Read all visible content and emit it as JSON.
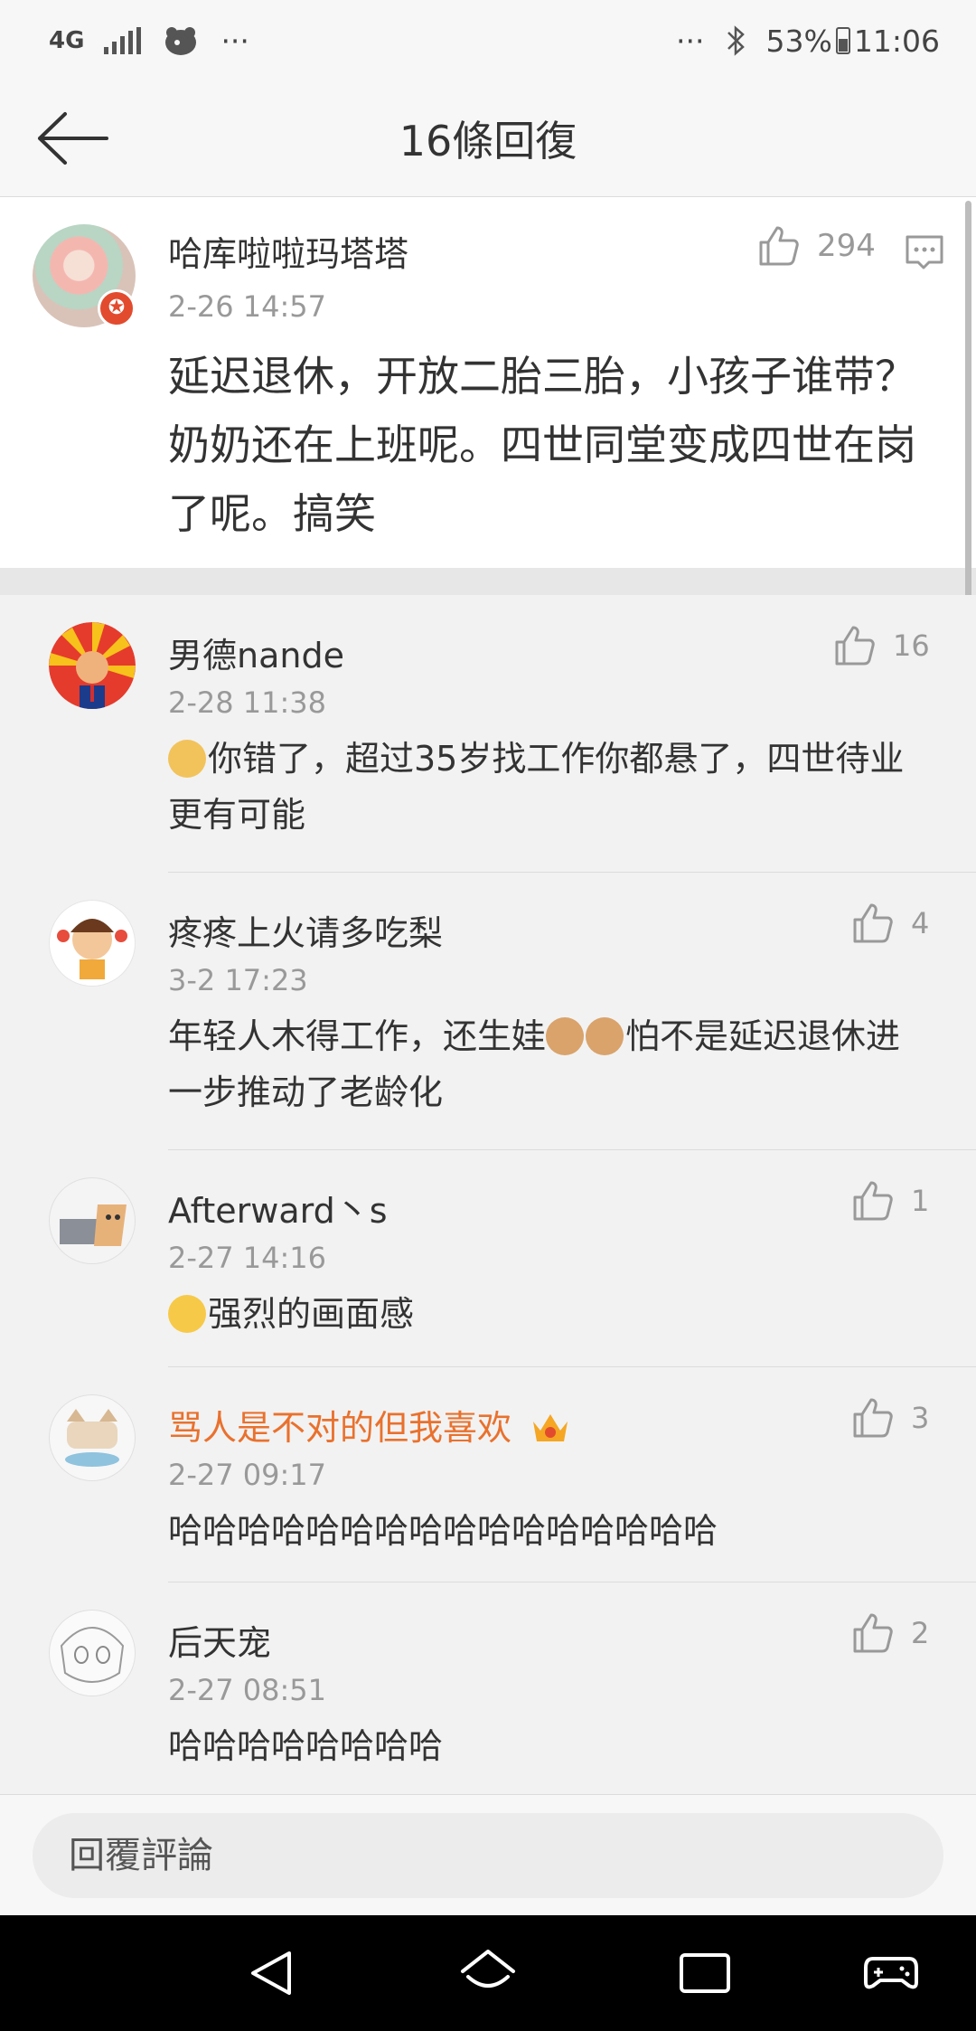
{
  "status_bar": {
    "network": "4G",
    "more": "···",
    "more_right": "···",
    "battery": "53%",
    "time": "11:06"
  },
  "header": {
    "title": "16條回復"
  },
  "main_comment": {
    "username": "哈库啦啦玛塔塔",
    "time": "2-26 14:57",
    "text": "延迟退休，开放二胎三胎，小孩子谁带？奶奶还在上班呢。四世同堂变成四世在岗了呢。搞笑",
    "likes": "294"
  },
  "replies": [
    {
      "username": "男德nande",
      "time": "2-28 11:38",
      "text": "你错了，超过35岁找工作你都悬了，四世待业更有可能",
      "likes": "16"
    },
    {
      "username": "疼疼上火请多吃梨",
      "time": "3-2 17:23",
      "text_before": "年轻人木得工作，还生娃",
      "text_after": "怕不是延迟退休进一步推动了老龄化",
      "likes": "4"
    },
    {
      "username": "Afterward丶s",
      "time": "2-27 14:16",
      "text": "强烈的画面感",
      "likes": "1"
    },
    {
      "username": "骂人是不对的但我喜欢",
      "time": "2-27 09:17",
      "text": "哈哈哈哈哈哈哈哈哈哈哈哈哈哈哈哈",
      "likes": "3"
    },
    {
      "username": "后天宠",
      "time": "2-27 08:51",
      "text": "哈哈哈哈哈哈哈哈",
      "likes": "2"
    }
  ],
  "reply_input": {
    "placeholder": "回覆評論"
  },
  "icons": {
    "back": "back-arrow-icon",
    "like": "thumbs-up-icon",
    "reply": "comment-icon"
  },
  "colors": {
    "accent_orange": "#e9712d",
    "verified_red": "#e24b2e",
    "muted_gray": "#999999"
  }
}
